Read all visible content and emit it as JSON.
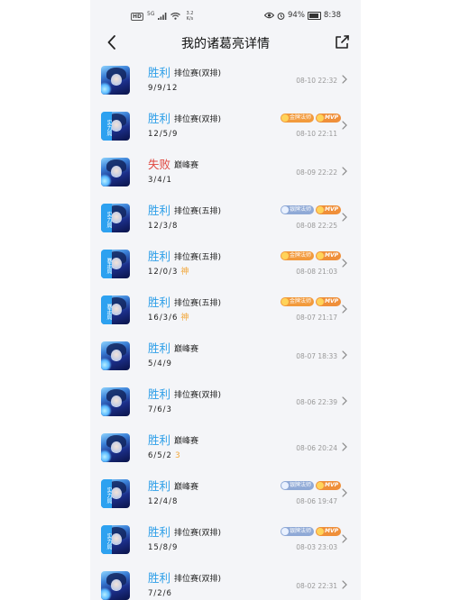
{
  "status_bar": {
    "hd": "HD",
    "signal": "5G",
    "net_speed": "3.2",
    "net_unit": "K/s",
    "battery": "94%",
    "time": "8:38"
  },
  "header": {
    "title": "我的诸葛亮详情"
  },
  "matches": [
    {
      "result": "胜利",
      "outcome": "win",
      "mode": "排位赛(双排)",
      "kda": "9/9/12",
      "extra": "",
      "time": "08-10 22:32",
      "tag": "",
      "badges": []
    },
    {
      "result": "胜利",
      "outcome": "win",
      "mode": "排位赛(双排)",
      "kda": "12/5/9",
      "extra": "",
      "time": "08-10 22:11",
      "tag": "实力局",
      "badges": [
        {
          "label": "金牌法师",
          "style": "gold"
        },
        {
          "label": "MVP",
          "style": "mvp"
        }
      ]
    },
    {
      "result": "失败",
      "outcome": "lose",
      "mode": "巅峰赛",
      "kda": "3/4/1",
      "extra": "",
      "time": "08-09 22:22",
      "tag": "",
      "badges": []
    },
    {
      "result": "胜利",
      "outcome": "win",
      "mode": "排位赛(五排)",
      "kda": "12/3/8",
      "extra": "",
      "time": "08-08 22:25",
      "tag": "实力局",
      "badges": [
        {
          "label": "银牌法师",
          "style": "silver"
        },
        {
          "label": "MVP",
          "style": "mvp"
        }
      ]
    },
    {
      "result": "胜利",
      "outcome": "win",
      "mode": "排位赛(五排)",
      "kda": "12/0/3",
      "extra": "神",
      "time": "08-08 21:03",
      "tag": "暴走局",
      "badges": [
        {
          "label": "金牌法师",
          "style": "gold"
        },
        {
          "label": "MVP",
          "style": "mvp"
        }
      ]
    },
    {
      "result": "胜利",
      "outcome": "win",
      "mode": "排位赛(五排)",
      "kda": "16/3/6",
      "extra": "神",
      "time": "08-07 21:17",
      "tag": "暴走局",
      "badges": [
        {
          "label": "金牌法师",
          "style": "gold"
        },
        {
          "label": "MVP",
          "style": "mvp"
        }
      ]
    },
    {
      "result": "胜利",
      "outcome": "win",
      "mode": "巅峰赛",
      "kda": "5/4/9",
      "extra": "",
      "time": "08-07 18:33",
      "tag": "",
      "badges": []
    },
    {
      "result": "胜利",
      "outcome": "win",
      "mode": "排位赛(双排)",
      "kda": "7/6/3",
      "extra": "",
      "time": "08-06 22:39",
      "tag": "",
      "badges": []
    },
    {
      "result": "胜利",
      "outcome": "win",
      "mode": "巅峰赛",
      "kda": "6/5/2",
      "extra": "3",
      "time": "08-06 20:24",
      "tag": "",
      "badges": []
    },
    {
      "result": "胜利",
      "outcome": "win",
      "mode": "巅峰赛",
      "kda": "12/4/8",
      "extra": "",
      "time": "08-06 19:47",
      "tag": "实力局",
      "badges": [
        {
          "label": "银牌法师",
          "style": "silver"
        },
        {
          "label": "MVP",
          "style": "mvp"
        }
      ]
    },
    {
      "result": "胜利",
      "outcome": "win",
      "mode": "排位赛(双排)",
      "kda": "15/8/9",
      "extra": "",
      "time": "08-03 23:03",
      "tag": "实力局",
      "badges": [
        {
          "label": "银牌法师",
          "style": "silver"
        },
        {
          "label": "MVP",
          "style": "mvp"
        }
      ]
    },
    {
      "result": "胜利",
      "outcome": "win",
      "mode": "排位赛(双排)",
      "kda": "7/2/6",
      "extra": "",
      "time": "08-02 22:31",
      "tag": "",
      "badges": []
    }
  ]
}
